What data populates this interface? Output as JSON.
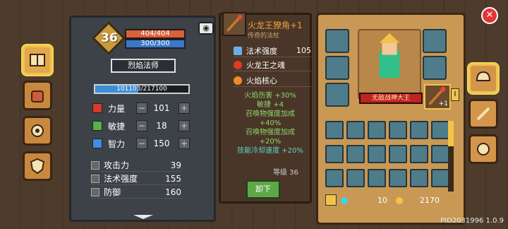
{
  "header": {
    "level": "36",
    "hp": "404/404",
    "mp": "300/300",
    "class_title": "烈焰法师",
    "xp": "101103/217100"
  },
  "left_tabs": [
    "book-icon",
    "backpack-icon",
    "gear-icon",
    "shield-icon"
  ],
  "attributes": [
    {
      "name": "力量",
      "value": "101",
      "color": "#d23b2a"
    },
    {
      "name": "敏捷",
      "value": "18",
      "color": "#54b34a"
    },
    {
      "name": "智力",
      "value": "150",
      "color": "#3f8ee0"
    }
  ],
  "sub_stats": [
    {
      "name": "攻击力",
      "value": "39"
    },
    {
      "name": "法术强度",
      "value": "155"
    },
    {
      "name": "防御",
      "value": "160"
    }
  ],
  "weapon": {
    "name": "火龙王獠角+1",
    "rarity": "传奇的法杖",
    "spell_power_label": "法术强度",
    "spell_power_value": "105",
    "gems": [
      "火龙王之魂",
      "火焰核心"
    ],
    "bonuses": [
      "火焰伤害 +30%",
      "敏捷 +4",
      "召唤物强度加成",
      "+40%",
      "召唤物强度加成",
      "+20%",
      "技能冷却速度 +20%"
    ],
    "level": "等级 36",
    "unequip": "卸下"
  },
  "hero_name": "无敌战神大王",
  "equip_badge": "+1",
  "currency": {
    "gems": "10",
    "gold": "2170"
  },
  "pid": "PID2031996 1.0.9",
  "colors": {
    "accent": "#f3a23c",
    "gold": "#f3c24a"
  }
}
